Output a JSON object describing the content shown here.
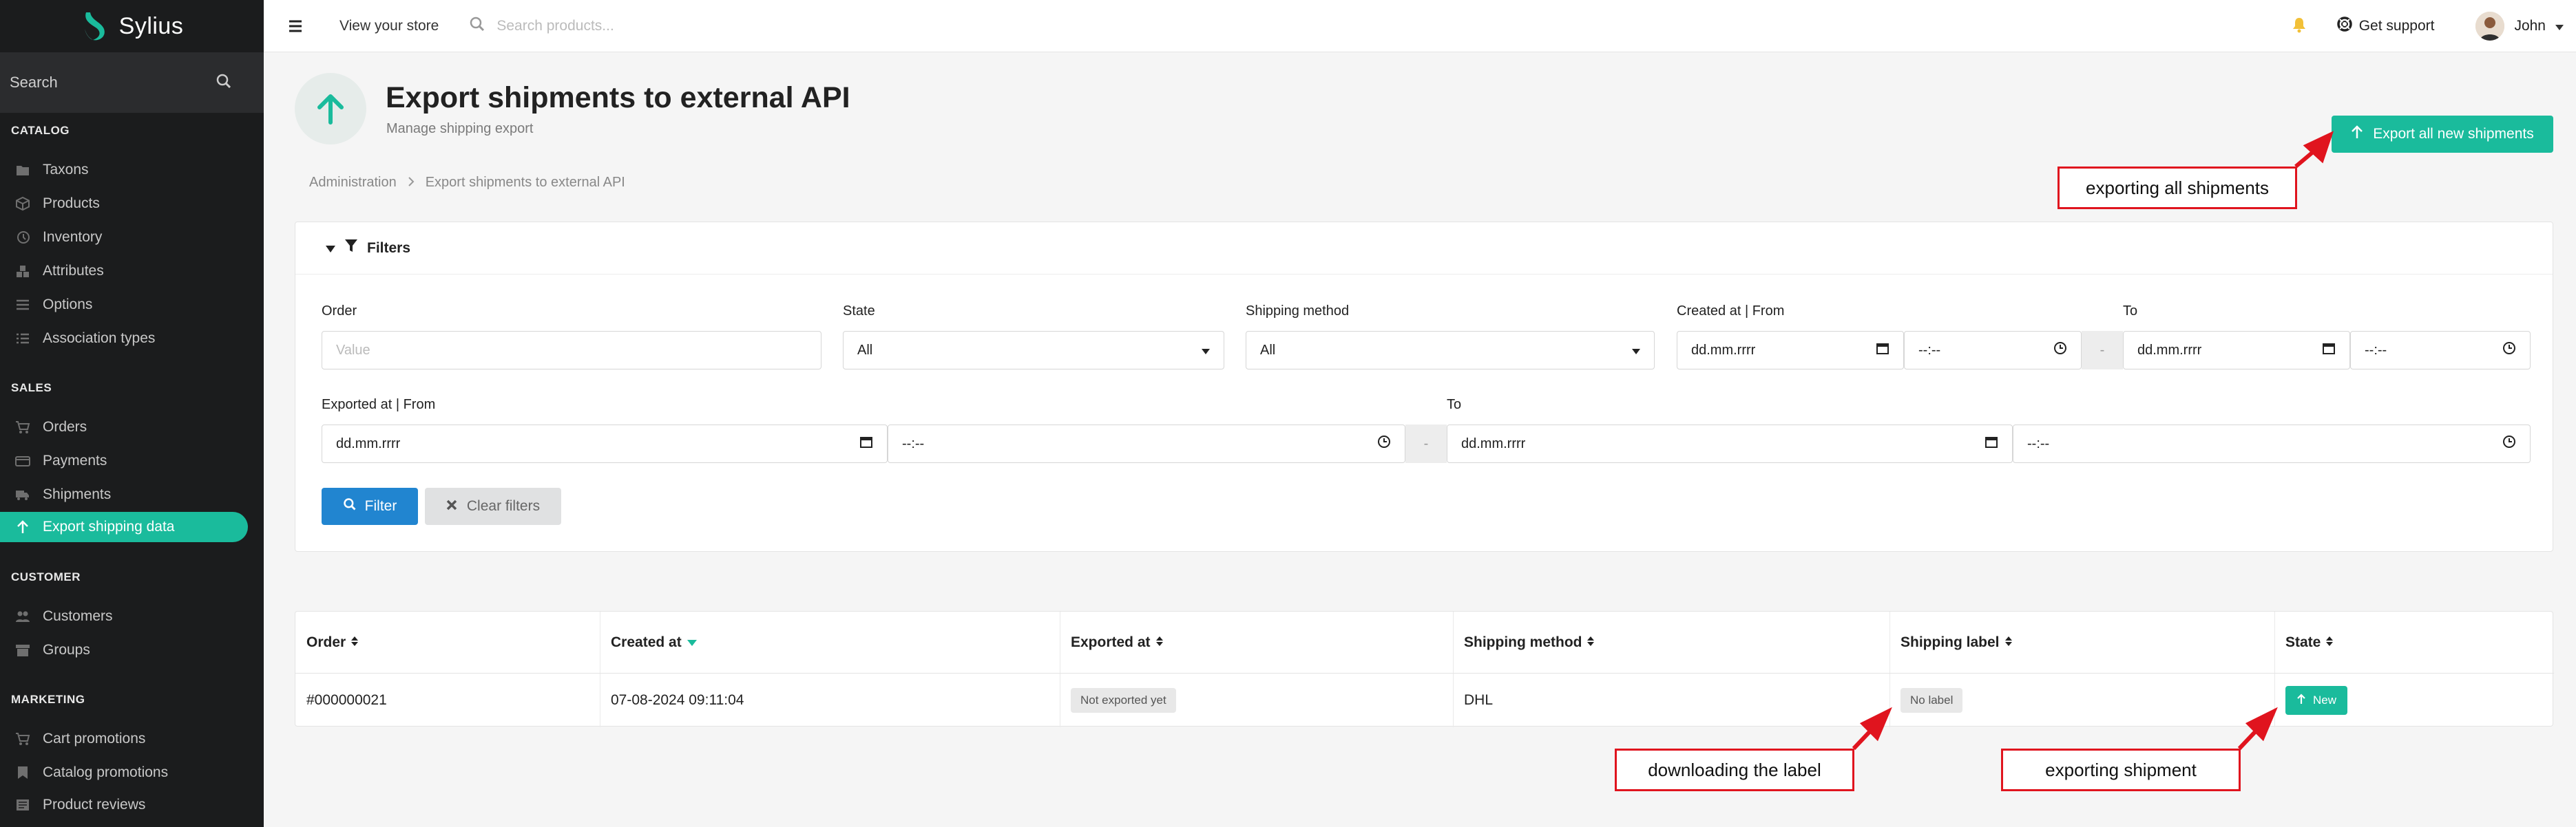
{
  "brand": {
    "name": "Sylius"
  },
  "sidebar": {
    "search_placeholder": "Search",
    "sections": [
      {
        "title": "CATALOG",
        "items": [
          {
            "label": "Taxons",
            "icon": "folder-icon"
          },
          {
            "label": "Products",
            "icon": "cube-icon"
          },
          {
            "label": "Inventory",
            "icon": "history-icon"
          },
          {
            "label": "Attributes",
            "icon": "cubes-icon"
          },
          {
            "label": "Options",
            "icon": "options-icon"
          },
          {
            "label": "Association types",
            "icon": "tasks-icon"
          }
        ]
      },
      {
        "title": "SALES",
        "items": [
          {
            "label": "Orders",
            "icon": "cart-icon"
          },
          {
            "label": "Payments",
            "icon": "payment-icon"
          },
          {
            "label": "Shipments",
            "icon": "truck-icon"
          },
          {
            "label": "Export shipping data",
            "icon": "arrow-up-icon",
            "active": true
          }
        ]
      },
      {
        "title": "CUSTOMER",
        "items": [
          {
            "label": "Customers",
            "icon": "users-icon"
          },
          {
            "label": "Groups",
            "icon": "archive-icon"
          }
        ]
      },
      {
        "title": "MARKETING",
        "items": [
          {
            "label": "Cart promotions",
            "icon": "cart-icon"
          },
          {
            "label": "Catalog promotions",
            "icon": "bookmark-icon"
          },
          {
            "label": "Product reviews",
            "icon": "newspaper-icon"
          }
        ]
      }
    ]
  },
  "topbar": {
    "view_store": "View your store",
    "search_placeholder": "Search products...",
    "support": "Get support",
    "user": "John"
  },
  "header": {
    "title": "Export shipments to external API",
    "subtitle": "Manage shipping export",
    "export_all_label": "Export all new shipments"
  },
  "breadcrumb": [
    "Administration",
    "Export shipments to external API"
  ],
  "filters": {
    "title": "Filters",
    "order": {
      "label": "Order",
      "placeholder": "Value"
    },
    "state": {
      "label": "State",
      "value": "All"
    },
    "shipping_method": {
      "label": "Shipping method",
      "value": "All"
    },
    "created_from": {
      "label": "Created at | From",
      "date": "dd.mm.rrrr",
      "time": "--:--"
    },
    "created_to": {
      "label": "To",
      "date": "dd.mm.rrrr",
      "time": "--:--"
    },
    "exported_from": {
      "label": "Exported at | From",
      "date": "dd.mm.rrrr",
      "time": "--:--"
    },
    "exported_to": {
      "label": "To",
      "date": "dd.mm.rrrr",
      "time": "--:--"
    },
    "dash": "-",
    "filter_label": "Filter",
    "clear_label": "Clear filters"
  },
  "table": {
    "columns": [
      "Order",
      "Created at",
      "Exported at",
      "Shipping method",
      "Shipping label",
      "State"
    ],
    "rows": [
      {
        "order": "#000000021",
        "created_at": "07-08-2024 09:11:04",
        "exported_at": "Not exported yet",
        "shipping_method": "DHL",
        "shipping_label": "No label",
        "state": "New"
      }
    ]
  },
  "annotations": {
    "export_all": "exporting all shipments",
    "download_label": "downloading the label",
    "export_one": "exporting shipment",
    "color": "#e0141e"
  },
  "colors": {
    "accent": "#1abb9c",
    "primary": "#2185d0",
    "sidebar": "#1b1c1d"
  }
}
